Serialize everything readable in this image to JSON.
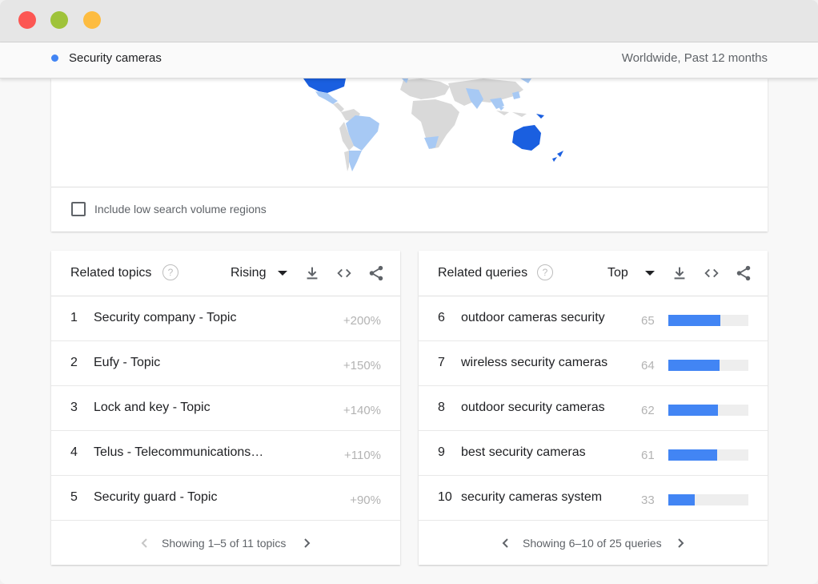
{
  "window": {
    "controls": [
      "close",
      "minimize",
      "zoom"
    ]
  },
  "header": {
    "term": "Security cameras",
    "scope": "Worldwide, Past 12 months",
    "term_color": "#4285f4"
  },
  "map": {
    "checkbox_label": "Include low search volume regions",
    "checkbox_checked": false,
    "colors": {
      "high": "#1a5fe0",
      "mid": "#a7c9f4",
      "none": "#d9d9d9"
    }
  },
  "related_topics": {
    "title": "Related topics",
    "help_icon": "help-circle-icon",
    "filter": "Rising",
    "rows": [
      {
        "rank": "1",
        "label": "Security company - Topic",
        "value": "+200%"
      },
      {
        "rank": "2",
        "label": "Eufy - Topic",
        "value": "+150%"
      },
      {
        "rank": "3",
        "label": "Lock and key - Topic",
        "value": "+140%"
      },
      {
        "rank": "4",
        "label": "Telus - Telecommunications…",
        "value": "+110%"
      },
      {
        "rank": "5",
        "label": "Security guard - Topic",
        "value": "+90%"
      }
    ],
    "pager": "Showing 1–5 of 11 topics"
  },
  "related_queries": {
    "title": "Related queries",
    "help_icon": "help-circle-icon",
    "filter": "Top",
    "rows": [
      {
        "rank": "6",
        "label": "outdoor cameras security",
        "value": "65",
        "fill": 0.65
      },
      {
        "rank": "7",
        "label": "wireless security cameras",
        "value": "64",
        "fill": 0.64
      },
      {
        "rank": "8",
        "label": "outdoor security cameras",
        "value": "62",
        "fill": 0.62
      },
      {
        "rank": "9",
        "label": "best security cameras",
        "value": "61",
        "fill": 0.61
      },
      {
        "rank": "10",
        "label": "security cameras system",
        "value": "33",
        "fill": 0.33
      }
    ],
    "pager": "Showing 6–10 of 25 queries"
  },
  "icons": {
    "download": "download-icon",
    "embed": "embed-code-icon",
    "share": "share-icon",
    "prev": "chevron-left-icon",
    "next": "chevron-right-icon"
  }
}
